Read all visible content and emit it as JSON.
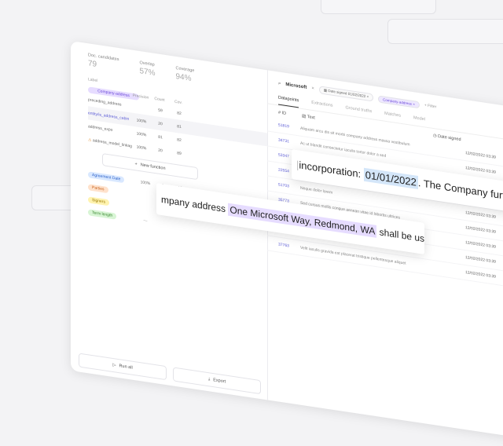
{
  "sidebar": {
    "stats": [
      {
        "label": "Doc. candidates",
        "value": "79"
      },
      {
        "label": "Overlap",
        "value": "57%"
      },
      {
        "label": "Coverage",
        "value": "94%"
      }
    ],
    "labels_title": "Label",
    "functions_header": {
      "precision": "Precision",
      "count": "Count",
      "coverage": "Cov."
    },
    "label_pill": "Company-address",
    "functions": [
      {
        "name": "preceding_address",
        "v1": "",
        "v2": "59",
        "v3": "82"
      },
      {
        "name": "entity/is_address_cabin",
        "v1": "100%",
        "v2": "20",
        "v3": "81"
      },
      {
        "name": "address_expo",
        "v1": "100%",
        "v2": "81",
        "v3": "82"
      },
      {
        "name": "address_model_linkage",
        "v1": "100%",
        "v2": "20",
        "v3": "89"
      }
    ],
    "new_function": "New function",
    "tags": [
      {
        "label": "Agreement Date",
        "color": "blue",
        "c1": "100%",
        "c2": "2",
        "c3": "16"
      },
      {
        "label": "Parties",
        "color": "orange",
        "c1": "",
        "c2": "",
        "c3": ""
      },
      {
        "label": "Signers",
        "color": "yellow",
        "c1": "",
        "c2": "",
        "c3": ""
      },
      {
        "label": "Term length",
        "color": "green",
        "c1": "—",
        "c2": "",
        "c3": ""
      }
    ],
    "run_all": "Run all",
    "export": "Export"
  },
  "main": {
    "search_query": "Microsoft",
    "filters": [
      {
        "label": "Date signed",
        "value": "01/02/2022"
      },
      {
        "label": "Company-address"
      }
    ],
    "add_filter": "Filter",
    "tabs": [
      "Datapoints",
      "Extractions",
      "Ground truths",
      "Matches",
      "Model"
    ],
    "columns": {
      "id": "ID",
      "text": "Text",
      "date": "Date signed"
    },
    "rows": [
      {
        "id": "51819",
        "text": "Aliquam arcu dis sit morbi company address massa vestibulum",
        "date": "12/02/2022 03:39"
      },
      {
        "id": "34731",
        "text": "Ac ut blandit consectetur iaculis tortor dolor a sed",
        "date": "12/02/2022 03:39"
      },
      {
        "id": "53347",
        "text": "Sed vestibulum",
        "date": "12/02/2022 03:39"
      },
      {
        "id": "22554",
        "text": "Quisque in urna",
        "date": "12/02/2022 03:39"
      },
      {
        "id": "51703",
        "text": "Neque dolor lorem",
        "date": "12/02/2022 03:39"
      },
      {
        "id": "35773",
        "text": "Sed cursus mollis congue aenean vitae id lobortis ultrices",
        "date": "12/02/2022 03:39"
      },
      {
        "id": "26309",
        "text": "Sodales gravida suspendisse id nascetur, fames aliquet id quam",
        "date": "12/02/2022 03:39"
      },
      {
        "id": "37763",
        "text": "Velit iaculis gravida et placerat tristique pellentesque aliquet",
        "date": "12/02/2022 03:39"
      },
      {
        "id": "37763",
        "text": "Velit iaculis gravida est placerat tristique pellentesque aliquet",
        "date": "12/02/2022 03:39"
      }
    ]
  },
  "zoom_address": {
    "prefix": "mpany address ",
    "highlight": "One Microsoft Way, Redmond, WA",
    "suffix": " shall be used f"
  },
  "zoom_date": {
    "prefix": "incorporation: ",
    "highlight": "01/01/2022",
    "suffix": ". The Company further sta"
  }
}
